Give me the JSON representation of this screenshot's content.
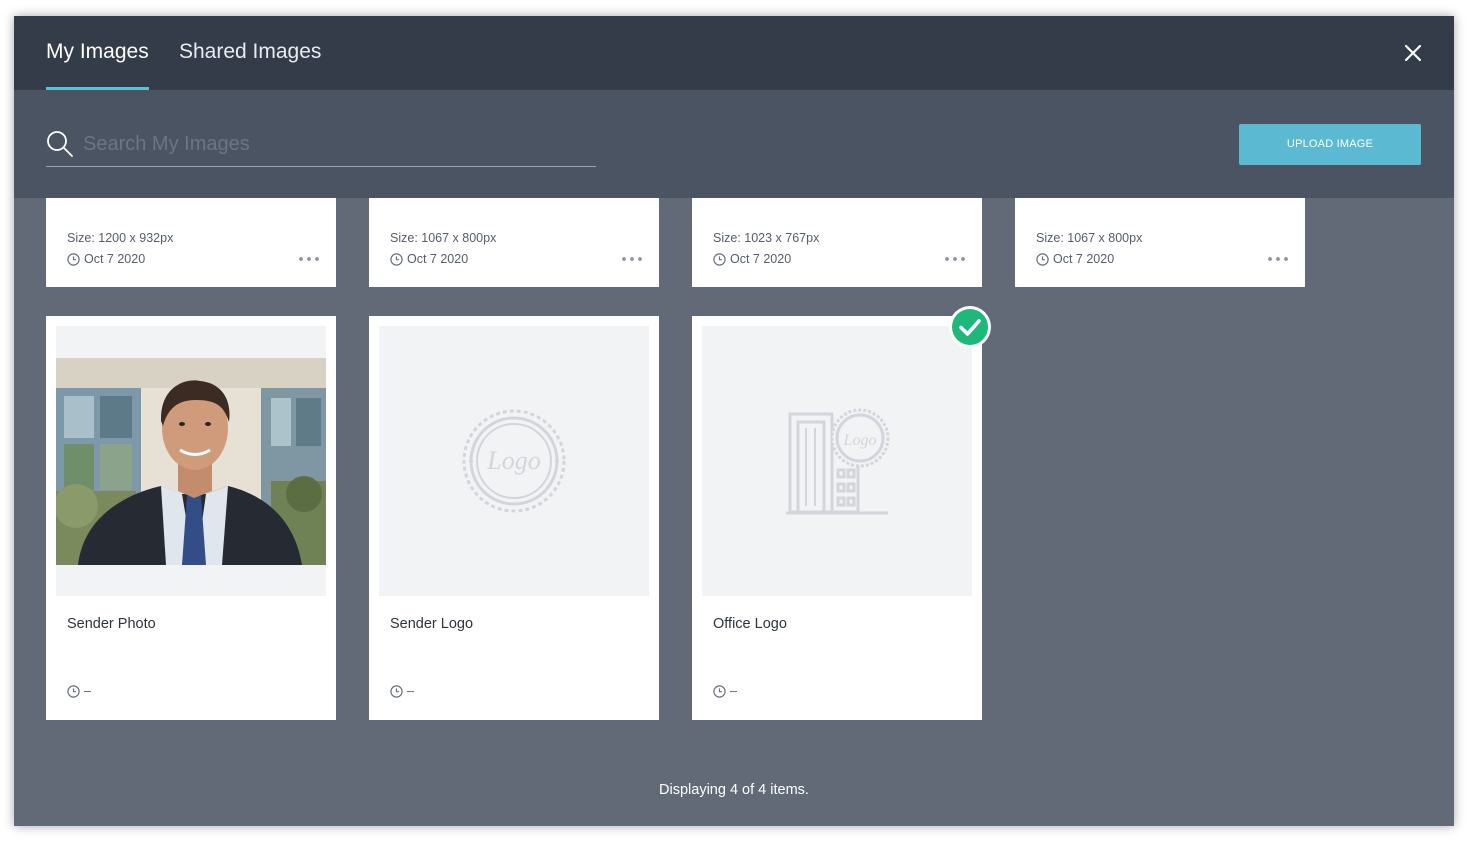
{
  "tabs": [
    {
      "label": "My Images",
      "active": true
    },
    {
      "label": "Shared Images",
      "active": false
    }
  ],
  "search": {
    "placeholder": "Search My Images",
    "value": ""
  },
  "upload_button_label": "UPLOAD IMAGE",
  "colors": {
    "accent": "#5bc0d4",
    "header_bg": "#343c49",
    "toolbar_bg": "#4b5462",
    "content_bg": "#636a77",
    "selected_check": "#1eb87a"
  },
  "top_cards": [
    {
      "size": "Size: 1200 x 932px",
      "date": "Oct 7 2020"
    },
    {
      "size": "Size: 1067 x 800px",
      "date": "Oct 7 2020"
    },
    {
      "size": "Size: 1023 x 767px",
      "date": "Oct 7 2020"
    },
    {
      "size": "Size: 1067 x 800px",
      "date": "Oct 7 2020"
    }
  ],
  "image_cards": [
    {
      "title": "Sender Photo",
      "date": "–",
      "thumbnail": "portrait-photo",
      "selected": false
    },
    {
      "title": "Sender Logo",
      "date": "–",
      "thumbnail": "logo-seal-icon",
      "selected": false,
      "thumbnail_text": "Logo"
    },
    {
      "title": "Office Logo",
      "date": "–",
      "thumbnail": "office-building-logo-icon",
      "selected": true,
      "thumbnail_text": "Logo"
    }
  ],
  "footer": {
    "text": "Displaying 4 of 4 items."
  }
}
